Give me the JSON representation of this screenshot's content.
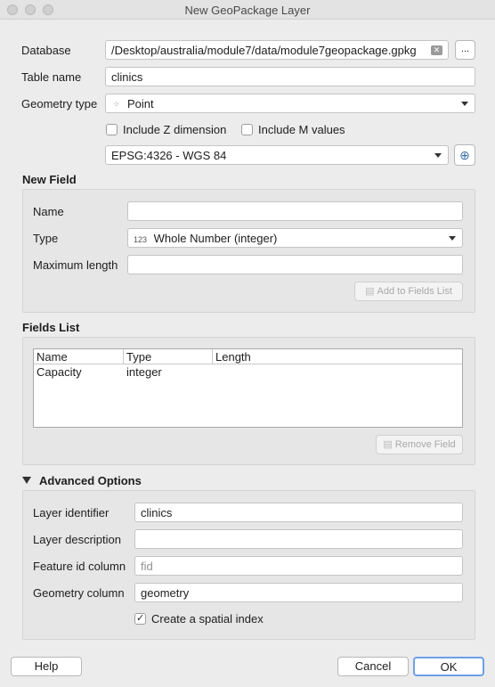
{
  "window": {
    "title": "New GeoPackage Layer"
  },
  "database": {
    "label": "Database",
    "value": "/Desktop/australia/module7/data/module7geopackage.gpkg",
    "browse_label": "..."
  },
  "table_name": {
    "label": "Table name",
    "value": "clinics"
  },
  "geometry_type": {
    "label": "Geometry type",
    "value": "Point"
  },
  "include_z": {
    "label": "Include Z dimension",
    "checked": false
  },
  "include_m": {
    "label": "Include M values",
    "checked": false
  },
  "crs": {
    "value": "EPSG:4326 - WGS 84"
  },
  "new_field": {
    "title": "New Field",
    "name_label": "Name",
    "name_value": "",
    "type_label": "Type",
    "type_prefix": "123",
    "type_value": "Whole Number (integer)",
    "max_length_label": "Maximum length",
    "max_length_value": "",
    "add_button": "Add to Fields List"
  },
  "fields_list": {
    "title": "Fields List",
    "columns": [
      "Name",
      "Type",
      "Length"
    ],
    "rows": [
      {
        "name": "Capacity",
        "type": "integer",
        "length": ""
      }
    ],
    "remove_button": "Remove Field"
  },
  "advanced": {
    "title": "Advanced Options",
    "layer_identifier_label": "Layer identifier",
    "layer_identifier_value": "clinics",
    "layer_description_label": "Layer description",
    "layer_description_value": "",
    "feature_id_label": "Feature id column",
    "feature_id_placeholder": "fid",
    "geometry_column_label": "Geometry column",
    "geometry_column_value": "geometry",
    "spatial_index_label": "Create a spatial index",
    "spatial_index_checked": true
  },
  "buttons": {
    "help": "Help",
    "cancel": "Cancel",
    "ok": "OK"
  },
  "colors": {
    "window_bg": "#ececec",
    "accent": "#3b82f6"
  }
}
